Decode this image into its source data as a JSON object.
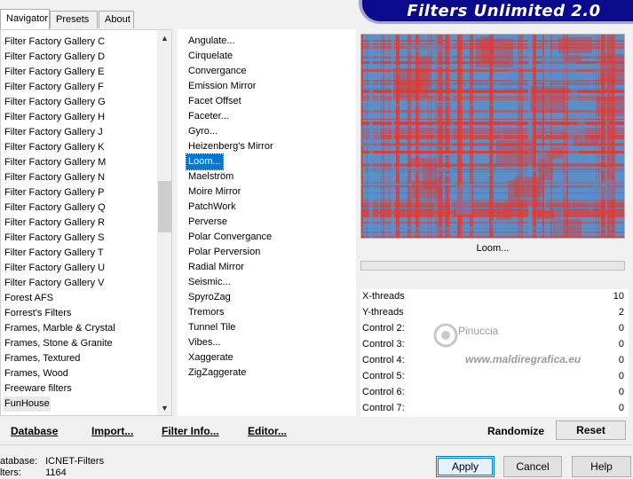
{
  "app": {
    "title": "Filters Unlimited 2.0"
  },
  "tabs": [
    {
      "label": "Navigator",
      "active": true
    },
    {
      "label": "Presets",
      "active": false
    },
    {
      "label": "About",
      "active": false
    }
  ],
  "categories": [
    "Filter Factory Gallery C",
    "Filter Factory Gallery D",
    "Filter Factory Gallery E",
    "Filter Factory Gallery F",
    "Filter Factory Gallery G",
    "Filter Factory Gallery H",
    "Filter Factory Gallery J",
    "Filter Factory Gallery K",
    "Filter Factory Gallery M",
    "Filter Factory Gallery N",
    "Filter Factory Gallery P",
    "Filter Factory Gallery Q",
    "Filter Factory Gallery R",
    "Filter Factory Gallery S",
    "Filter Factory Gallery T",
    "Filter Factory Gallery U",
    "Filter Factory Gallery V",
    "Forest AFS",
    "Forrest's Filters",
    "Frames, Marble & Crystal",
    "Frames, Stone & Granite",
    "Frames, Textured",
    "Frames, Wood",
    "Freeware filters",
    "FunHouse"
  ],
  "selected_category": "FunHouse",
  "filters": [
    "Angulate...",
    "Cirquelate",
    "Convergance",
    "Emission Mirror",
    "Facet Offset",
    "Faceter...",
    "Gyro...",
    "Heizenberg's Mirror",
    "Loom...",
    "Maelström",
    "Moire Mirror",
    "PatchWork",
    "Perverse",
    "Polar Convergance",
    "Polar Perversion",
    "Radial Mirror",
    "Seismic...",
    "SpyroZag",
    "Tremors",
    "Tunnel Tile",
    "Vibes...",
    "Xaggerate",
    "ZigZaggerate"
  ],
  "selected_filter": "Loom...",
  "preview": {
    "filter_name": "Loom...",
    "colors": [
      "#e03a32",
      "#5b8fc8"
    ]
  },
  "controls": [
    {
      "label": "X-threads",
      "value": "10"
    },
    {
      "label": "Y-threads",
      "value": "2"
    },
    {
      "label": "Control 2:",
      "value": "0"
    },
    {
      "label": "Control 3:",
      "value": "0"
    },
    {
      "label": "Control 4:",
      "value": "0"
    },
    {
      "label": "Control 5:",
      "value": "0"
    },
    {
      "label": "Control 6:",
      "value": "0"
    },
    {
      "label": "Control 7:",
      "value": "0"
    }
  ],
  "bottom_links": [
    "Database",
    "Import...",
    "Filter Info...",
    "Editor..."
  ],
  "randomize_label": "Randomize",
  "reset_label": "Reset",
  "status": {
    "database_label": "atabase:",
    "database_value": "ICNET-Filters",
    "filters_label": "lters:",
    "filters_value": "1164"
  },
  "buttons": {
    "apply": "Apply",
    "cancel": "Cancel",
    "help": "Help"
  },
  "watermark": {
    "name": "Pinuccia",
    "site": "www.maldiregrafica.eu"
  }
}
